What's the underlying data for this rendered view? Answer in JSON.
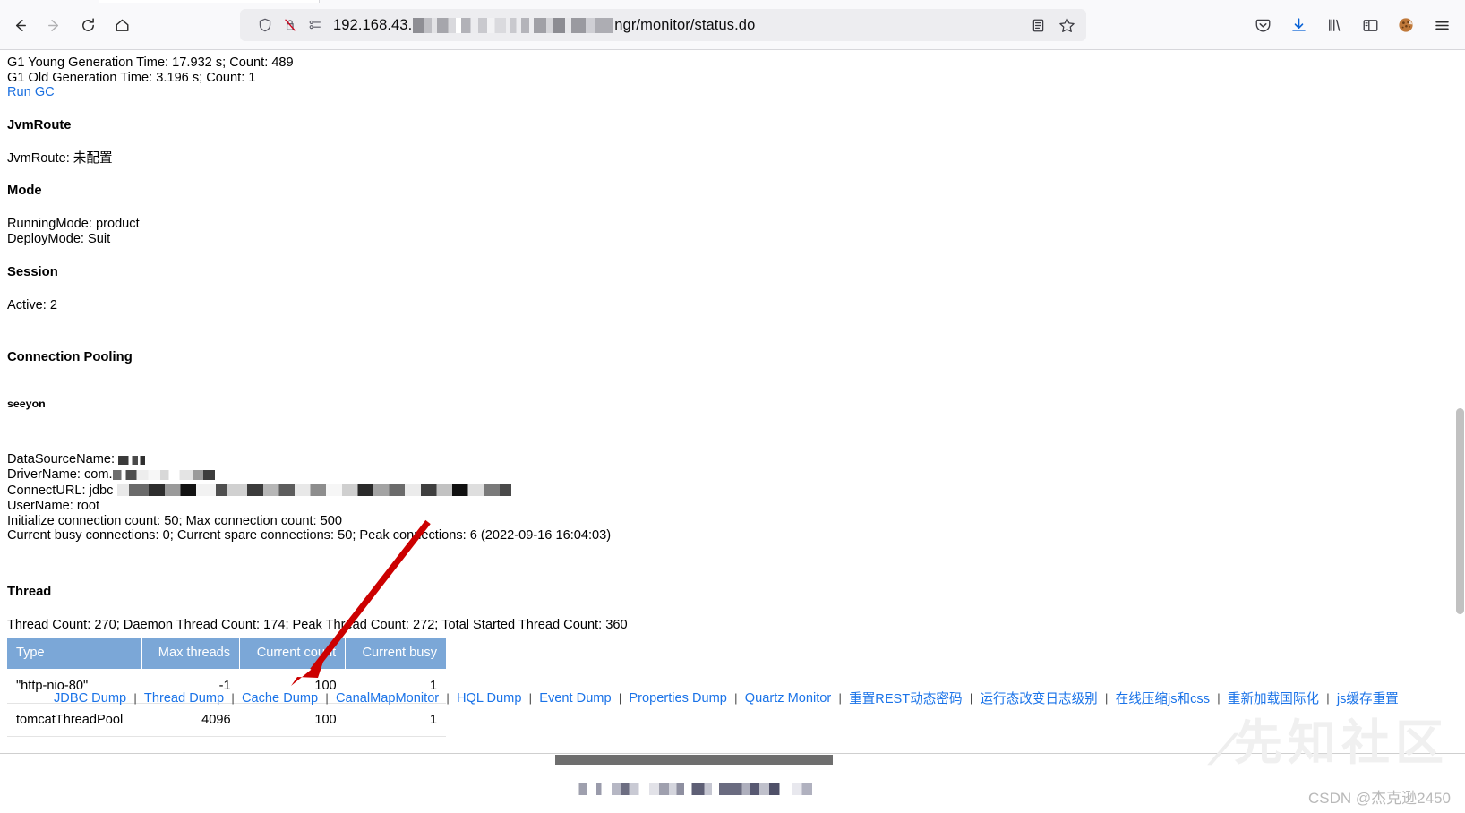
{
  "browser": {
    "nav": {
      "back": "back-arrow",
      "forward": "forward-arrow",
      "reload": "reload",
      "home": "home"
    },
    "urlbar": {
      "shield_icon": "shield-icon",
      "permission_icon": "blocked-autoplay-icon",
      "sso_icon": "form-autofill-icon",
      "url_prefix": "192.168.43.",
      "url_suffix": "ngr/monitor/status.do",
      "url_redacted": true,
      "reader_icon": "reader-view-icon",
      "bookmark_icon": "bookmark-star-icon"
    },
    "toolbar": [
      {
        "name": "pocket-icon",
        "label": "Pocket"
      },
      {
        "name": "downloads-icon",
        "label": "Downloads"
      },
      {
        "name": "library-icon",
        "label": "Library"
      },
      {
        "name": "sidebar-icon",
        "label": "Sidebars"
      },
      {
        "name": "cookie-avatar-icon",
        "label": "Account"
      },
      {
        "name": "hamburger-menu-icon",
        "label": "Open application menu"
      }
    ]
  },
  "page": {
    "gc": {
      "young": "G1 Young Generation  Time: 17.932 s; Count: 489",
      "old": "G1 Old Generation  Time: 3.196 s; Count: 1",
      "run_gc_link": "Run GC"
    },
    "jvmroute": {
      "heading": "JvmRoute",
      "value": "JvmRoute: 未配置"
    },
    "mode": {
      "heading": "Mode",
      "running_mode": "RunningMode: product",
      "deploy_mode": "DeployMode: Suit"
    },
    "session": {
      "heading": "Session",
      "active": "Active: 2"
    },
    "connection_pooling": {
      "heading": "Connection Pooling",
      "pool_name": "seeyon",
      "datasource_label": "DataSourceName:",
      "driver_label": "DriverName: com.",
      "connecturl_label": "ConnectURL: jdbc",
      "username": "UserName: root",
      "counts": "Initialize connection count: 50; Max connection count: 500",
      "current": "Current busy connections: 0; Current spare connections: 50; Peak connections: 6 (2022-09-16 16:04:03)"
    },
    "thread": {
      "heading": "Thread",
      "summary": "Thread Count: 270; Daemon Thread Count: 174; Peak Thread Count: 272; Total Started Thread Count: 360",
      "columns": [
        "Type",
        "Max threads",
        "Current count",
        "Current busy"
      ],
      "rows": [
        {
          "type": "\"http-nio-80\"",
          "max_threads": "-1",
          "current_count": "100",
          "current_busy": "1"
        },
        {
          "type": "tomcatThreadPool",
          "max_threads": "4096",
          "current_count": "100",
          "current_busy": "1"
        }
      ]
    },
    "footer_links": [
      "JDBC Dump",
      "Thread Dump",
      "Cache Dump",
      "CanalMapMonitor",
      "HQL Dump",
      "Event Dump",
      "Properties Dump",
      "Quartz Monitor",
      "重置REST动态密码",
      "运行态改变日志级别",
      "在线压缩js和css",
      "重新加载国际化",
      "js缓存重置"
    ],
    "separator": "|"
  },
  "annotation": {
    "arrow_color": "#cc0000",
    "arrow_from": "Current busy column header",
    "arrow_to": "Cache Dump link"
  },
  "watermarks": {
    "site": "先知社区",
    "credit": "CSDN @杰克逊2450"
  },
  "colors": {
    "link": "#1a73e8",
    "table_header_bg": "#7ba7d7",
    "arrow": "#cc0000",
    "scrollbar_thumb": "#6e6e6e"
  }
}
